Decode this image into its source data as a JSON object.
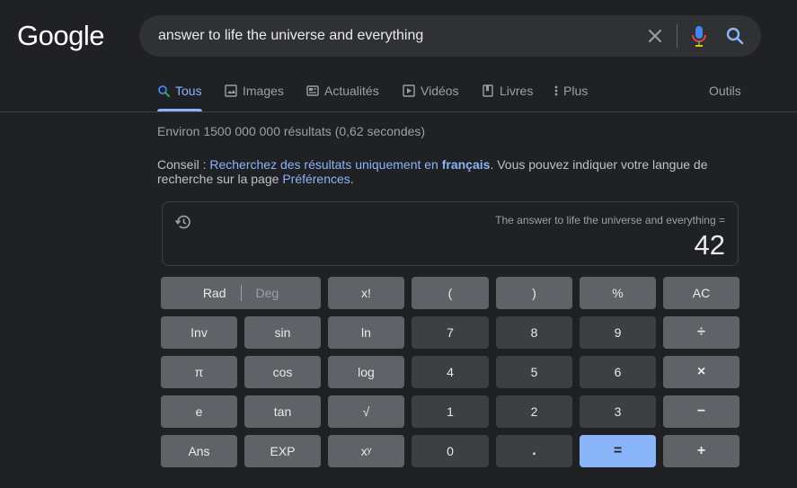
{
  "logo": "Google",
  "search": {
    "query": "answer to life the universe and everything"
  },
  "tabs": [
    {
      "label": "Tous",
      "icon": "search-icon"
    },
    {
      "label": "Images",
      "icon": "image-icon"
    },
    {
      "label": "Actualités",
      "icon": "news-icon"
    },
    {
      "label": "Vidéos",
      "icon": "play-icon"
    },
    {
      "label": "Livres",
      "icon": "book-icon"
    },
    {
      "label": "Plus",
      "icon": "more-vert-icon"
    }
  ],
  "tools_label": "Outils",
  "result_stats": "Environ 1500 000 000 résultats (0,62 secondes)",
  "tip": {
    "prefix": "Conseil : ",
    "link1": "Recherchez des résultats uniquement en ",
    "link1_bold": "français",
    "middle": ". Vous pouvez indiquer votre langue de recherche sur la page ",
    "link2": "Préférences",
    "suffix": "."
  },
  "calculator": {
    "expression": "The answer to life the universe and everything =",
    "result": "42",
    "keys": {
      "rad": "Rad",
      "deg": "Deg",
      "fact": "x!",
      "lparen": "(",
      "rparen": ")",
      "percent": "%",
      "ac": "AC",
      "inv": "Inv",
      "sin": "sin",
      "ln": "ln",
      "seven": "7",
      "eight": "8",
      "nine": "9",
      "divide": "÷",
      "pi": "π",
      "cos": "cos",
      "log": "log",
      "four": "4",
      "five": "5",
      "six": "6",
      "multiply": "×",
      "e": "e",
      "tan": "tan",
      "sqrt": "√",
      "one": "1",
      "two": "2",
      "three": "3",
      "minus": "−",
      "ans": "Ans",
      "exp": "EXP",
      "pow": "xʸ",
      "zero": "0",
      "dot": ".",
      "equals": "=",
      "plus": "+"
    }
  }
}
